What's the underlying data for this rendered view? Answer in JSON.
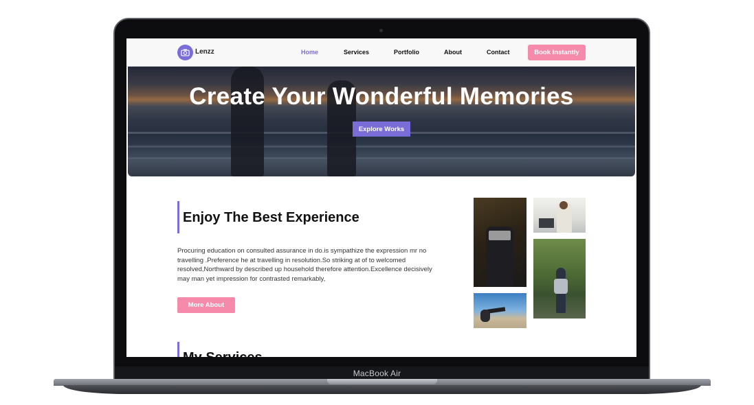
{
  "device": {
    "brand_label": "MacBook Air"
  },
  "nav": {
    "logo_text": "Lenzz",
    "links": [
      "Home",
      "Services",
      "Portfolio",
      "About",
      "Contact"
    ],
    "active": "Home",
    "cta_label": "Book Instantly"
  },
  "hero": {
    "title": "Create Your Wonderful Memories",
    "button_label": "Explore Works"
  },
  "about": {
    "title": "Enjoy The Best Experience",
    "paragraph": "Procuring education on consulted assurance in do.is sympathize the expression mr no travelling .Preference he at travelling in resolution.So striking at of to welcomed resolved,Northward by described up household therefore attention.Excellence decisively may man yet impression for contrasted remarkably,",
    "button_label": "More About"
  },
  "services": {
    "title": "My Services"
  },
  "colors": {
    "accent": "#7b6dd8",
    "pink": "#f58aaa",
    "dark": "#111111"
  },
  "icons": {
    "logo": "camera-icon"
  }
}
